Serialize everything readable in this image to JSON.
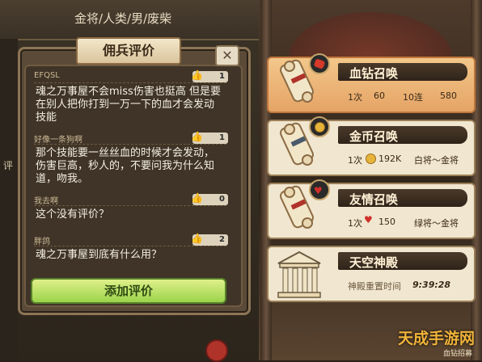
{
  "header": {
    "hero_name": "金将/人类/男/废柴"
  },
  "left_edge_glyph": "评",
  "dialog": {
    "title": "佣兵评价",
    "close_label": "✕",
    "reviews": [
      {
        "user": "EFQSL",
        "likes": "1",
        "text": "魂之万事屋不会miss伤害也挺高 但是要在别人把你打到一万一下的血才会发动技能"
      },
      {
        "user": "好像一条狗啊",
        "likes": "1",
        "text": "那个技能要一丝丝血的时候才会发动，伤害巨高，秒人的，不要问我为什么知道，吻我。"
      },
      {
        "user": "我去啊",
        "likes": "0",
        "text": "这个没有评价？"
      },
      {
        "user": "胖鸽",
        "likes": "2",
        "text": "魂之万事屋到底有什么用？"
      }
    ],
    "add_review_label": "添加评价"
  },
  "summons": [
    {
      "title": "血钻召唤",
      "single_label": "1次",
      "single_cost": "60",
      "ten_label": "10连",
      "ten_cost": "580",
      "selected": true
    },
    {
      "title": "金币召唤",
      "single_label": "1次",
      "single_cost": "192K",
      "range_text": "白将～金将"
    },
    {
      "title": "友情召唤",
      "single_label": "1次",
      "single_cost": "150",
      "range_text": "绿将～金将"
    },
    {
      "title": "天空神殿",
      "reset_label": "神殿重置时间",
      "reset_time": "9:39:28"
    }
  ],
  "watermark": {
    "main": "天成手游网",
    "sub": "血钻招募"
  },
  "colors": {
    "accent_orange": "#e5a466",
    "panel_cream": "#f1e6cf",
    "button_green": "#9bd34a"
  }
}
